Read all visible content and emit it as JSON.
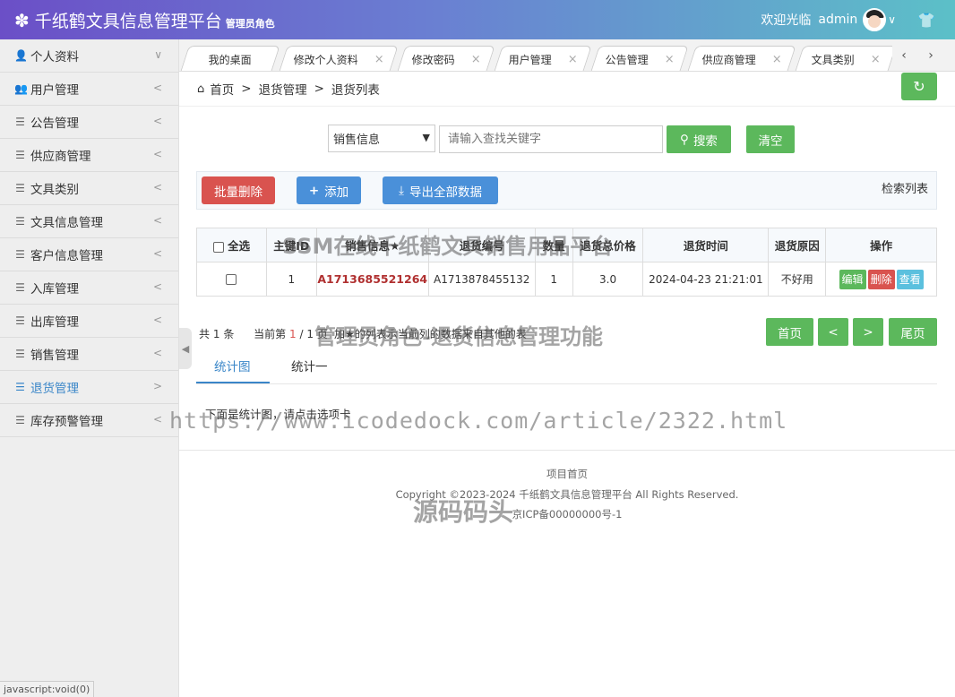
{
  "header": {
    "title": "千纸鹤文具信息管理平台",
    "role_tag": "管理员角色",
    "welcome": "欢迎光临",
    "username": "admin"
  },
  "sidebar": {
    "items": [
      {
        "label": "个人资料",
        "icon": "user-icon",
        "arrow": "∨"
      },
      {
        "label": "用户管理",
        "icon": "users-icon",
        "arrow": "<"
      },
      {
        "label": "公告管理",
        "icon": "list-icon",
        "arrow": "<"
      },
      {
        "label": "供应商管理",
        "icon": "list-icon",
        "arrow": "<"
      },
      {
        "label": "文具类别",
        "icon": "list-icon",
        "arrow": "<"
      },
      {
        "label": "文具信息管理",
        "icon": "list-icon",
        "arrow": "<"
      },
      {
        "label": "客户信息管理",
        "icon": "list-icon",
        "arrow": "<"
      },
      {
        "label": "入库管理",
        "icon": "list-icon",
        "arrow": "<"
      },
      {
        "label": "出库管理",
        "icon": "list-icon",
        "arrow": "<"
      },
      {
        "label": "销售管理",
        "icon": "list-icon",
        "arrow": "<"
      },
      {
        "label": "退货管理",
        "icon": "list-icon",
        "arrow": ">"
      },
      {
        "label": "库存预警管理",
        "icon": "list-icon",
        "arrow": "<"
      }
    ],
    "active_index": 10
  },
  "status_bar": "javascript:void(0)",
  "tabs": [
    "我的桌面",
    "修改个人资料",
    "修改密码",
    "用户管理",
    "公告管理",
    "供应商管理",
    "文具类别"
  ],
  "tab_close": "×",
  "breadcrumb": {
    "home": "首页",
    "sep": ">",
    "level1": "退货管理",
    "level2": "退货列表"
  },
  "search": {
    "select_value": "销售信息",
    "placeholder": "请输入查找关键字",
    "search_label": "搜索",
    "clear_label": "清空"
  },
  "toolbar": {
    "batch_delete": "批量删除",
    "add": "添加",
    "export": "导出全部数据",
    "search_list": "检索列表"
  },
  "table": {
    "select_all": "全选",
    "headers": [
      "主键ID",
      "销售信息★",
      "退货编号",
      "数量",
      "退货总价格",
      "退货时间",
      "退货原因",
      "操作"
    ],
    "rows": [
      {
        "id": "1",
        "sale_info": "A1713685521264",
        "return_no": "A1713878455132",
        "qty": "1",
        "total_price": "3.0",
        "return_time": "2024-04-23 21:21:01",
        "reason": "不好用"
      }
    ],
    "actions": {
      "edit": "编辑",
      "delete": "删除",
      "view": "查看"
    }
  },
  "pager": {
    "total_prefix": "共",
    "total": "1",
    "total_suffix": "条",
    "current_prefix": "当前第",
    "current": "1",
    "pages": "/ 1 页",
    "note": "加★的列表示当前列的数据来自其他的表",
    "first": "首页",
    "prev": "<",
    "next": ">",
    "last": "尾页"
  },
  "chart_tabs": [
    "统计图",
    "统计一"
  ],
  "chart_hint": "下面是统计图，请点击选项卡",
  "footer": {
    "home": "项目首页",
    "copyright": "Copyright ©2023-2024 千纸鹤文具信息管理平台 All Rights Reserved.",
    "icp": "京ICP备00000000号-1"
  },
  "watermarks": {
    "line1": "SSM在线千纸鹤文具销售用品平台",
    "line2": "管理员角色-退货信息管理功能",
    "line3": "https://www.icodedock.com/article/2322.html",
    "line4": "源码码头"
  }
}
